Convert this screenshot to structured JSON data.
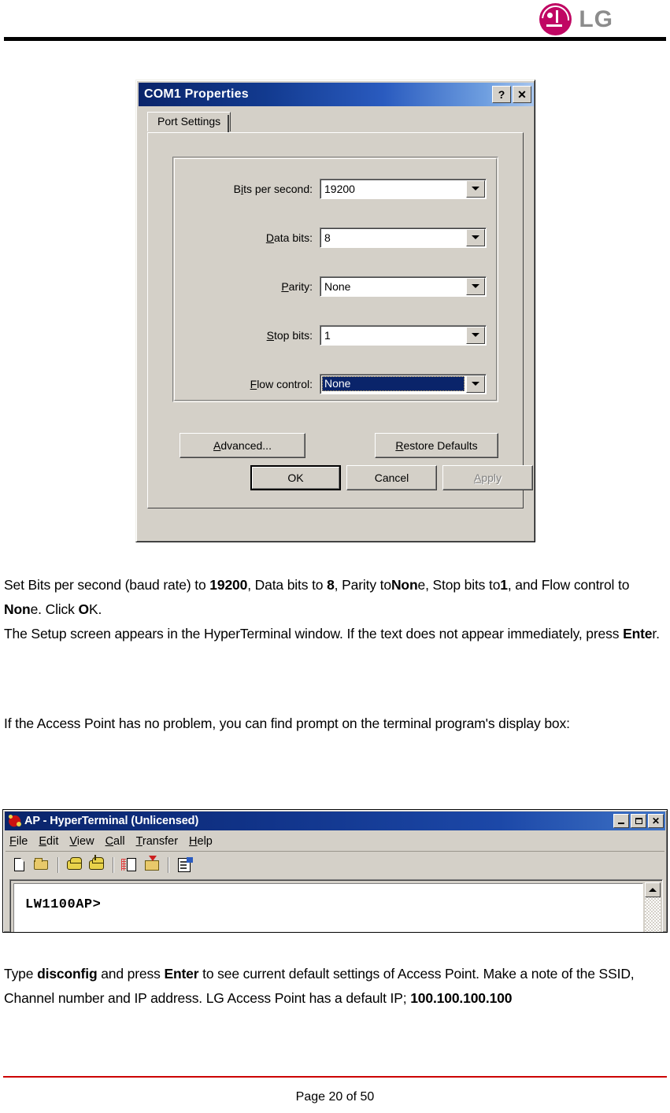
{
  "header": {
    "logo_text": "LG",
    "logo_color": "#c00663",
    "logo_word_color": "#8c8c8c"
  },
  "dialog": {
    "title": "COM1 Properties",
    "help_button": "?",
    "close_button": "✕",
    "tab": "Port Settings",
    "fields": [
      {
        "label_pre": "B",
        "label_accel": "i",
        "label_post": "ts per second:",
        "value": "19200",
        "selected": false
      },
      {
        "label_pre": "",
        "label_accel": "D",
        "label_post": "ata bits:",
        "value": "8",
        "selected": false
      },
      {
        "label_pre": "",
        "label_accel": "P",
        "label_post": "arity:",
        "value": "None",
        "selected": false
      },
      {
        "label_pre": "",
        "label_accel": "S",
        "label_post": "top bits:",
        "value": "1",
        "selected": false
      },
      {
        "label_pre": "",
        "label_accel": "F",
        "label_post": "low control:",
        "value": "None",
        "selected": true
      }
    ],
    "buttons": {
      "advanced_pre": "",
      "advanced_accel": "A",
      "advanced_post": "dvanced...",
      "restore_pre": "",
      "restore_accel": "R",
      "restore_post": "estore Defaults",
      "ok": "OK",
      "cancel": "Cancel",
      "apply_pre": "",
      "apply_accel": "A",
      "apply_post": "pply",
      "apply_disabled": true
    }
  },
  "body": {
    "para1_segments": [
      {
        "t": "Set Bits per second (baud rate) to ",
        "b": false
      },
      {
        "t": "19200",
        "b": true
      },
      {
        "t": ", Data bits to ",
        "b": false
      },
      {
        "t": "8",
        "b": true
      },
      {
        "t": ", Parity to",
        "b": false
      },
      {
        "t": "Non",
        "b": true
      },
      {
        "t": "e, Stop bits to",
        "b": false
      },
      {
        "t": "1",
        "b": true
      },
      {
        "t": ", and Flow control to ",
        "b": false
      },
      {
        "t": "Non",
        "b": true
      },
      {
        "t": "e. Click ",
        "b": false
      },
      {
        "t": "O",
        "b": true
      },
      {
        "t": "K.",
        "b": false
      },
      {
        "t": "\n",
        "b": false
      },
      {
        "t": "The Setup screen appears in the HyperTerminal window. If the text does not appear immediately, press ",
        "b": false
      },
      {
        "t": "Ente",
        "b": true
      },
      {
        "t": "r.",
        "b": false
      }
    ],
    "para2_segments": [
      {
        "t": "If the Access Point has no problem, you can find prompt on the terminal program's display box:",
        "b": false
      }
    ],
    "para3_segments": [
      {
        "t": "Type ",
        "b": false
      },
      {
        "t": "disconfig",
        "b": true
      },
      {
        "t": " and press ",
        "b": false
      },
      {
        "t": "Enter",
        "b": true
      },
      {
        "t": " to see current default settings of Access Point. Make a note of the SSID, Channel number and IP address. LG Access Point has a default IP; ",
        "b": false
      },
      {
        "t": "100.100.100.100",
        "b": true
      }
    ]
  },
  "hyperterminal": {
    "title": "AP - HyperTerminal (Unlicensed)",
    "minimize": "_",
    "maximize": "□",
    "close": "✕",
    "menu": [
      {
        "accel": "F",
        "rest": "ile"
      },
      {
        "accel": "E",
        "rest": "dit"
      },
      {
        "accel": "V",
        "rest": "iew"
      },
      {
        "accel": "C",
        "rest": "all"
      },
      {
        "accel": "T",
        "rest": "ransfer"
      },
      {
        "accel": "H",
        "rest": "elp"
      }
    ],
    "toolbar_icons": [
      "new-connection-icon",
      "open-connection-icon",
      "call-icon",
      "disconnect-icon",
      "receive-file-icon",
      "send-file-icon",
      "properties-icon"
    ],
    "terminal_text": "LW1100AP>"
  },
  "footer": {
    "page_text": "Page 20 of 50",
    "rule_color": "#cc0000"
  }
}
